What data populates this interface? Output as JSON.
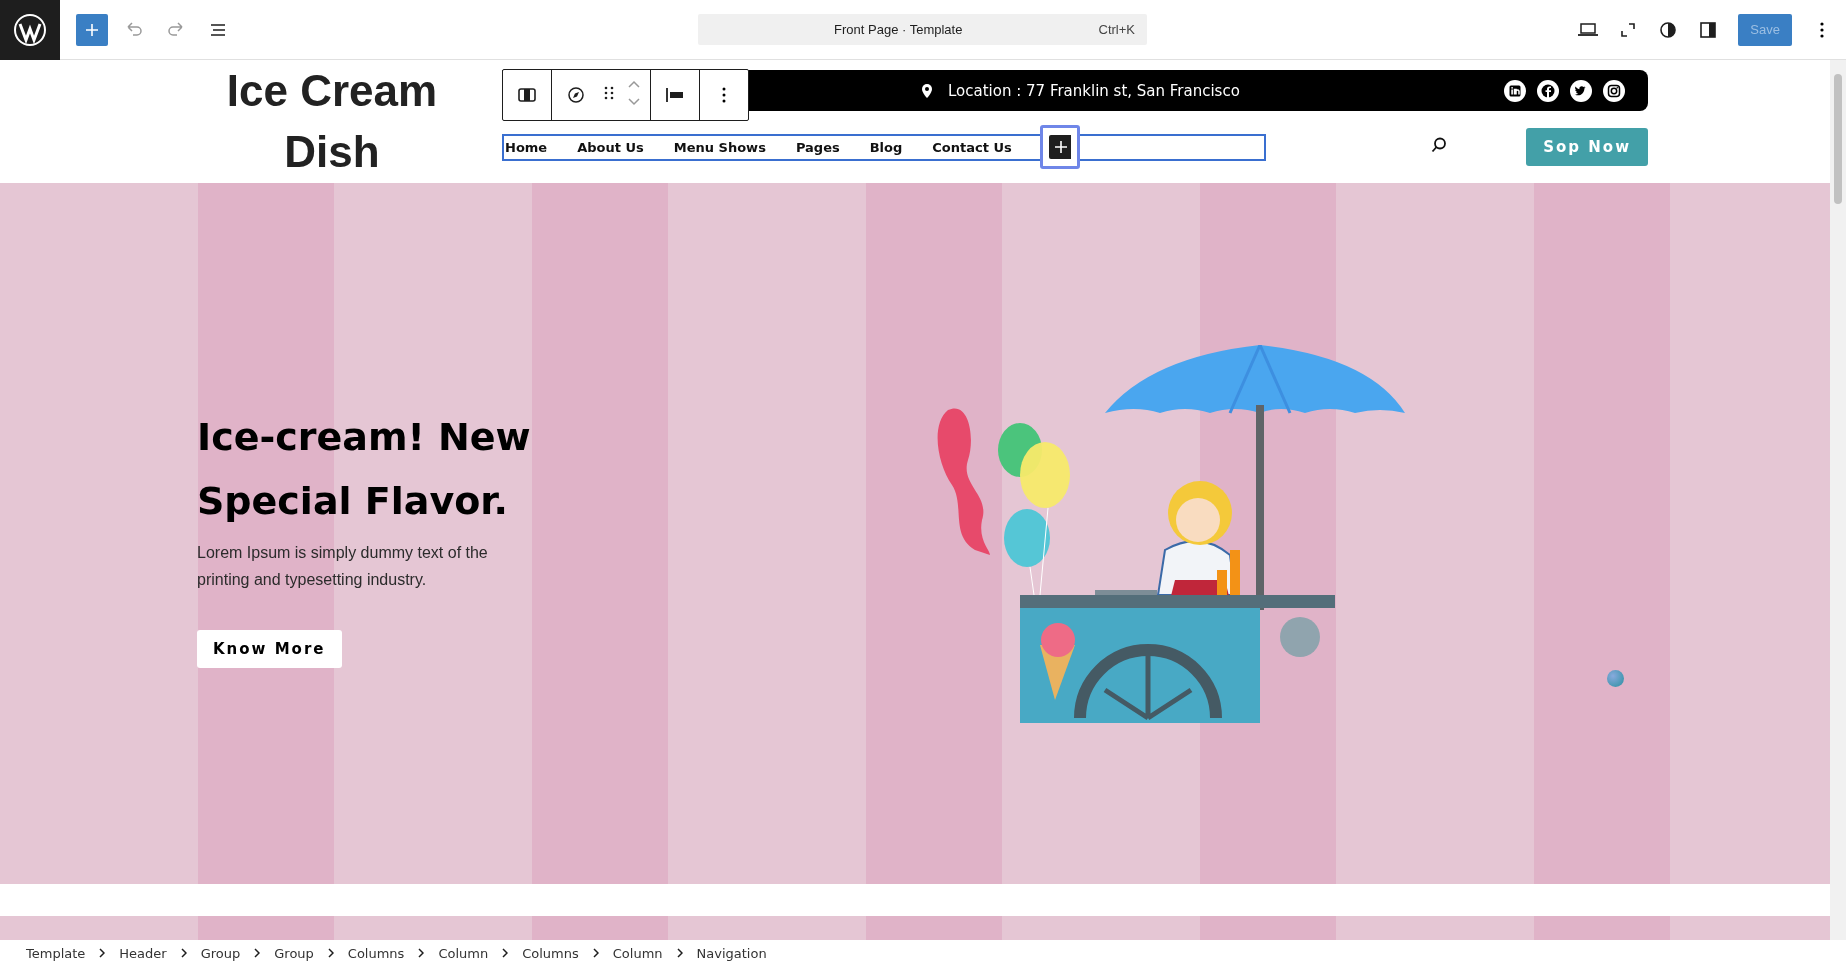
{
  "editor_bar": {
    "document_title": "Front Page · Template",
    "shortcut": "Ctrl+K",
    "save_button": {
      "label": "Save",
      "disabled": true
    }
  },
  "header": {
    "site_title": "Ice Cream Dish",
    "location": "Location : 77 Franklin st, San Francisco",
    "navigation": [
      {
        "label": "Home"
      },
      {
        "label": "About Us"
      },
      {
        "label": "Menu Shows"
      },
      {
        "label": "Pages"
      },
      {
        "label": "Blog"
      },
      {
        "label": "Contact Us"
      }
    ],
    "cta_button": "Sop Now"
  },
  "hero": {
    "heading": "Ice-cream! New Special Flavor.",
    "text": "Lorem Ipsum is simply dummy text of the printing and typesetting industry.",
    "button": "Know More"
  },
  "breadcrumbs": [
    "Template",
    "Header",
    "Group",
    "Group",
    "Columns",
    "Column",
    "Columns",
    "Column",
    "Navigation"
  ]
}
